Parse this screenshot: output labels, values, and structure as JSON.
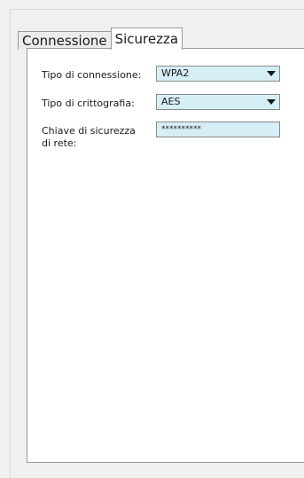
{
  "tabs": [
    {
      "label": "Connessione",
      "active": false
    },
    {
      "label": "Sicurezza",
      "active": true
    }
  ],
  "form": {
    "connection_type": {
      "label": "Tipo di connessione:",
      "value": "WPA2"
    },
    "encryption_type": {
      "label": "Tipo di crittografia:",
      "value": "AES"
    },
    "network_key": {
      "label_line1": "Chiave di sicurezza",
      "label_line2": "di rete:",
      "value": "**********"
    }
  },
  "icons": {
    "dropdown": "triangle-down-icon"
  }
}
